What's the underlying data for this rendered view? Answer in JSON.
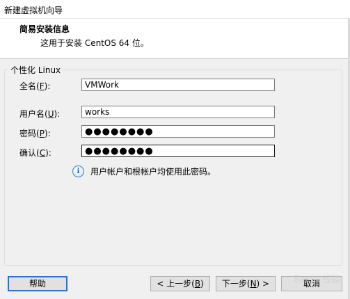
{
  "window": {
    "title": "新建虚拟机向导"
  },
  "header": {
    "title": "简易安装信息",
    "subtitle": "这用于安装 CentOS 64 位。"
  },
  "group": {
    "legend": "个性化 Linux"
  },
  "fields": {
    "fullname": {
      "label_prefix": "全名(",
      "mnemonic": "F",
      "label_suffix": "):",
      "value": "VMWork"
    },
    "username": {
      "label_prefix": "用户名(",
      "mnemonic": "U",
      "label_suffix": "):",
      "value": "works"
    },
    "password": {
      "label_prefix": "密码(",
      "mnemonic": "P",
      "label_suffix": "):",
      "value": "●●●●●●●●"
    },
    "confirm": {
      "label_prefix": "确认(",
      "mnemonic": "C",
      "label_suffix": "):",
      "value": "●●●●●●●●"
    }
  },
  "info": {
    "icon": "info-icon",
    "text": "用户帐户和根帐户均使用此密码。"
  },
  "buttons": {
    "help": {
      "prefix": "帮助",
      "mnemonic": "",
      "suffix": ""
    },
    "back": {
      "prefix": "< 上一步(",
      "mnemonic": "B",
      "suffix": ")"
    },
    "next": {
      "prefix": "下一步(",
      "mnemonic": "N",
      "suffix": ") >"
    },
    "cancel": {
      "prefix": "取消",
      "mnemonic": "",
      "suffix": ""
    }
  },
  "watermark": {
    "text": "Baidu 经验"
  },
  "colors": {
    "accent": "#2f6fd0",
    "window_bg": "#f0f0f0",
    "header_bg": "#ffffff"
  }
}
